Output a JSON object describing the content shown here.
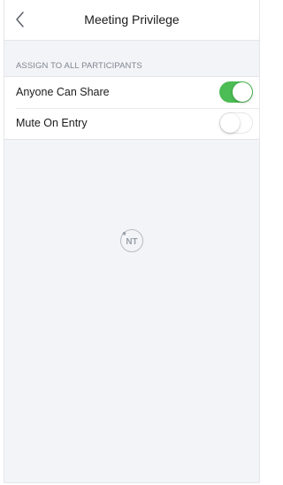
{
  "nav": {
    "title": "Meeting Privilege",
    "back_icon": "chevron-left-icon"
  },
  "section": {
    "header": "ASSIGN TO ALL PARTICIPANTS"
  },
  "settings": [
    {
      "label": "Anyone Can Share",
      "enabled": true
    },
    {
      "label": "Mute On Entry",
      "enabled": false
    }
  ],
  "watermark": {
    "text": "NT"
  },
  "colors": {
    "toggle_on": "#4cbc54",
    "background": "#f3f4f7"
  }
}
